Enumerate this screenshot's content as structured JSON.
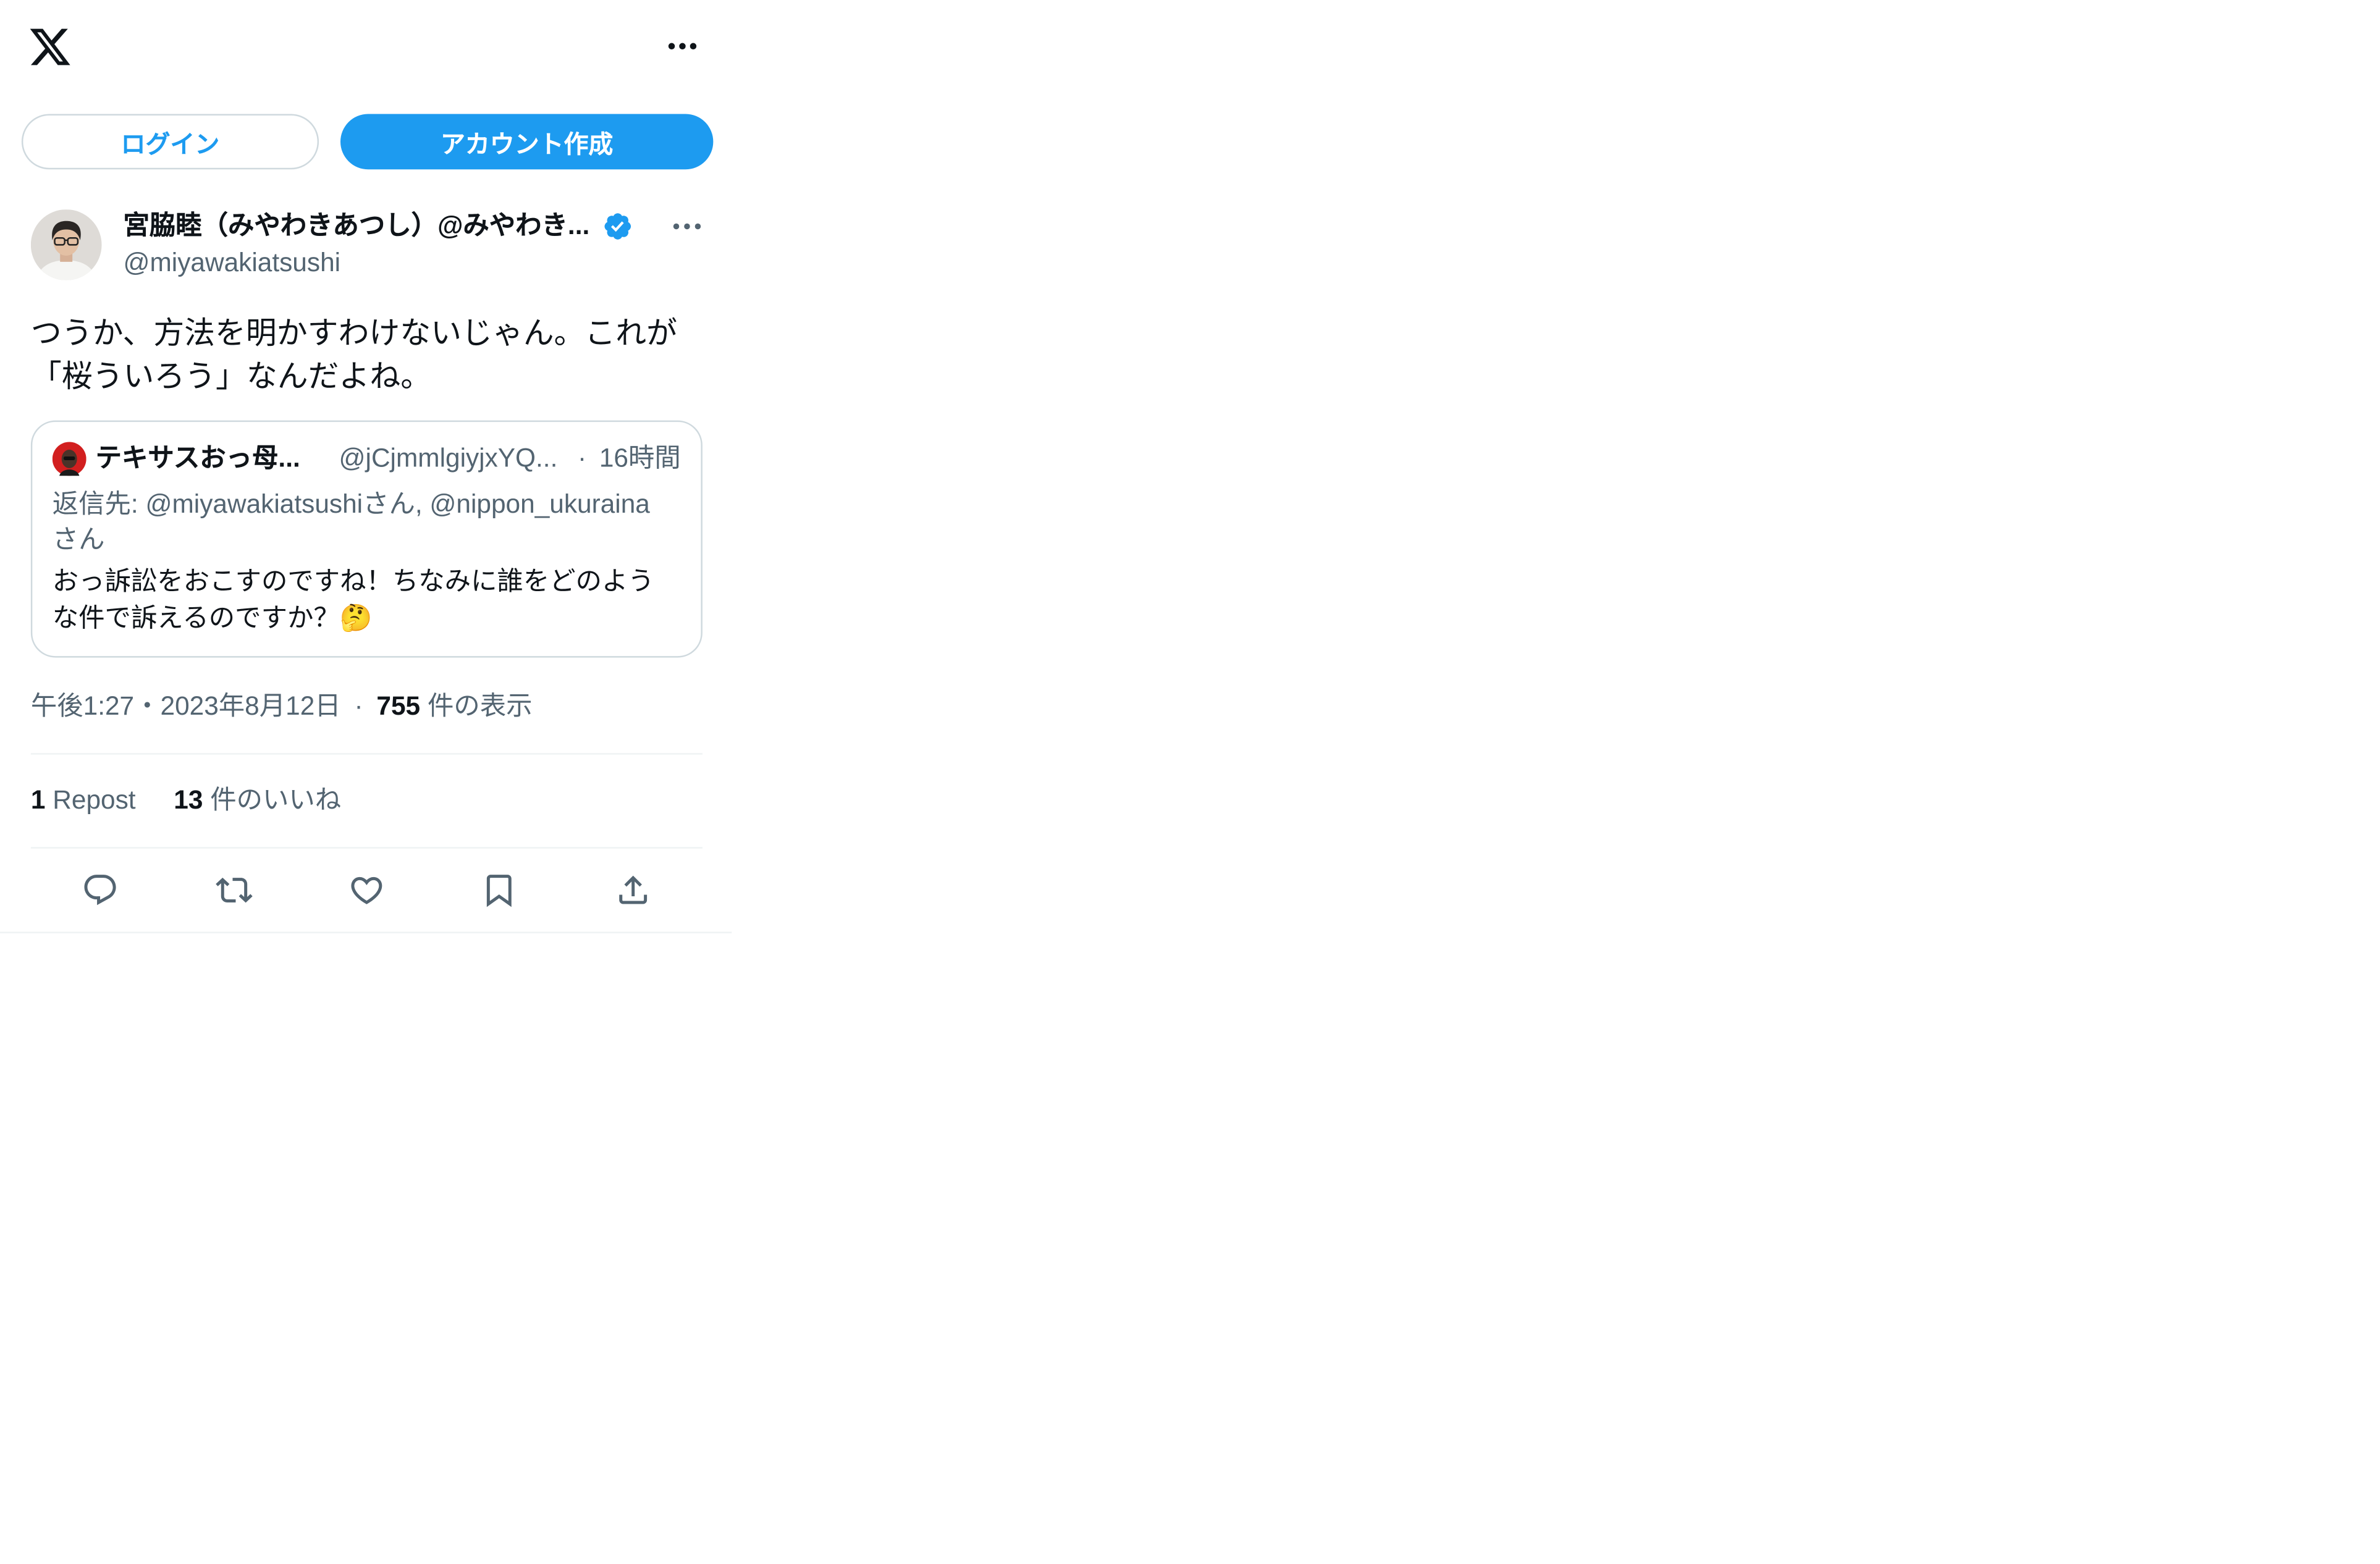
{
  "header": {
    "logo_icon": "x-logo-icon",
    "more_icon": "more-horizontal-icon"
  },
  "auth": {
    "login_label": "ログイン",
    "signup_label": "アカウント作成"
  },
  "tweet": {
    "author": {
      "display_name": "宮脇睦（みやわきあつし）@みやわき...",
      "handle": "@miyawakiatsushi",
      "verified_icon": "verified-badge-icon"
    },
    "text": [
      "つうか、方法を明かすわけないじゃん。これが",
      "「桜ういろう」なんだよね。"
    ],
    "quote": {
      "display_name": "テキサスおっ母...",
      "handle": "@jCjmmlgiyjxYQ...",
      "separator": "·",
      "time": "16時間",
      "reply_to": [
        "返信先: @miyawakiatsushiさん, @nippon_ukuraina",
        "さん"
      ],
      "text": [
        "おっ訴訟をおこすのですね！ちなみに誰をどのよう",
        "な件で訴えるのですか？🤔"
      ]
    },
    "meta": {
      "timestamp": "午後1:27・2023年8月12日",
      "separator": "·",
      "views_count": "755",
      "views_label": "件の表示"
    },
    "stats": {
      "reposts_count": "1",
      "reposts_label": "Repost",
      "likes_count": "13",
      "likes_label": "件のいいね"
    },
    "actions": [
      {
        "icon": "reply-icon"
      },
      {
        "icon": "repost-icon"
      },
      {
        "icon": "like-icon"
      },
      {
        "icon": "bookmark-icon"
      },
      {
        "icon": "share-icon"
      }
    ]
  },
  "colors": {
    "accent": "#1d9bf0",
    "text_primary": "#0f1419",
    "text_secondary": "#536471",
    "border": "#cfd9de",
    "divider": "#eff3f4"
  }
}
